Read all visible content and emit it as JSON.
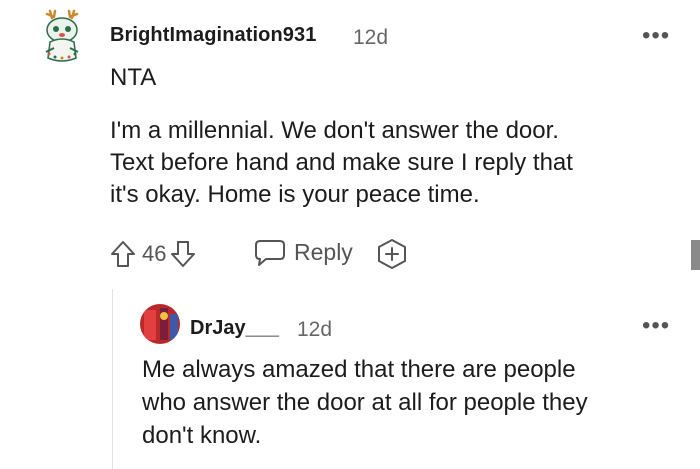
{
  "comment": {
    "username": "BrightImagination931",
    "age": "12d",
    "more_label": "•••",
    "lines": [
      "NTA",
      "I'm a millennial. We don't answer the door.",
      "Text before hand and make sure I reply that",
      "it's okay. Home is your peace time."
    ],
    "score": "46",
    "reply_label": "Reply"
  },
  "reply": {
    "username": "DrJay___",
    "age": "12d",
    "more_label": "•••",
    "lines": [
      "Me always amazed that there are people",
      "who answer the door at all for people they",
      "don't know."
    ]
  },
  "icons": {
    "upvote": "upvote-arrow-icon",
    "downvote": "downvote-arrow-icon",
    "reply": "speech-bubble-icon",
    "award": "award-plus-icon",
    "more": "more-options-icon"
  },
  "colors": {
    "text": "#1c1c1c",
    "muted": "#666666",
    "icon": "#555555",
    "thread_line": "#e2e2e2"
  }
}
